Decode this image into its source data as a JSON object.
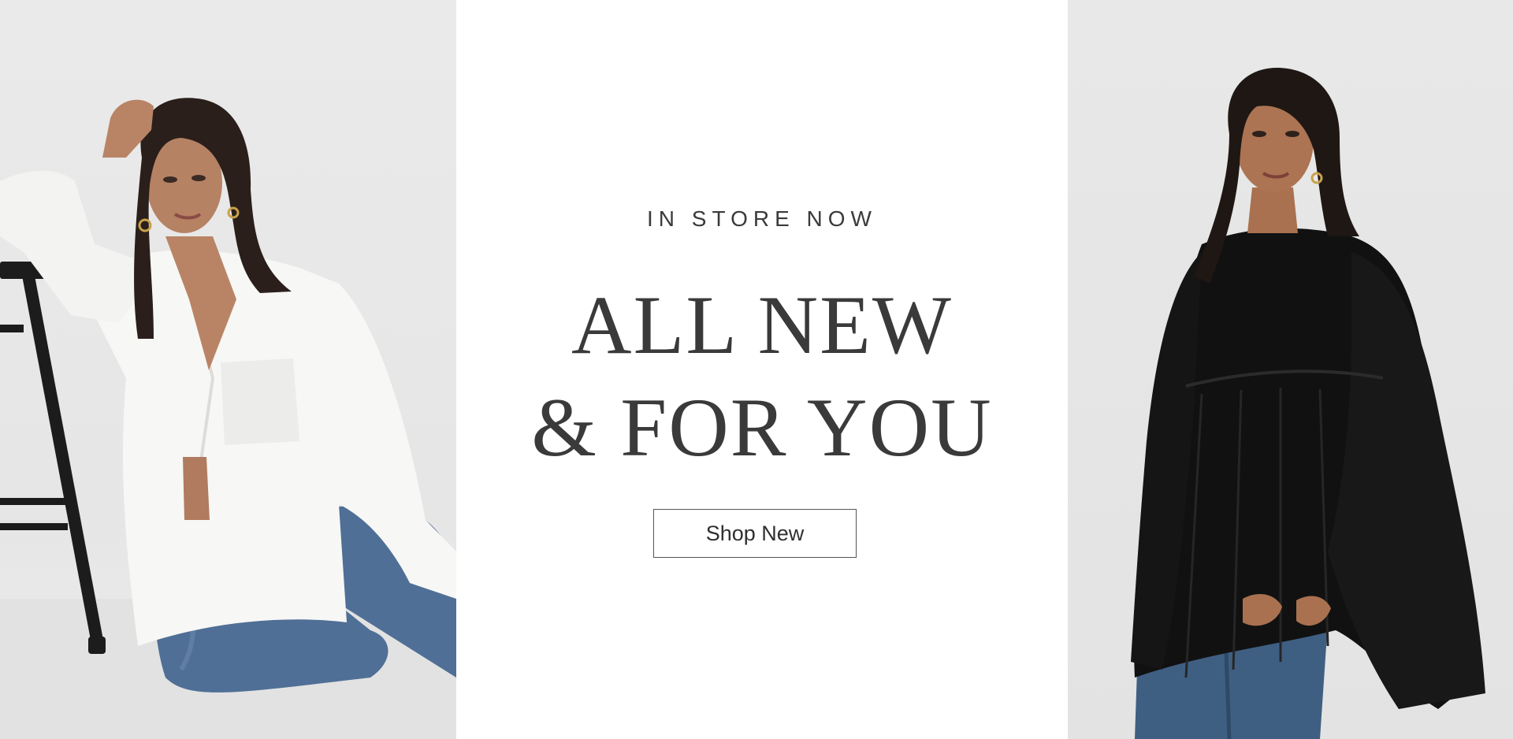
{
  "promo": {
    "eyebrow": "IN STORE NOW",
    "headline_line1": "ALL NEW",
    "headline_line2": "& FOR YOU",
    "cta_label": "Shop New"
  },
  "images": {
    "left": "model-white-shirt-photo",
    "right": "model-black-blouse-photo"
  },
  "colors": {
    "text": "#3a3a3a",
    "background": "#ffffff",
    "photo_background": "#e8e8e8"
  }
}
